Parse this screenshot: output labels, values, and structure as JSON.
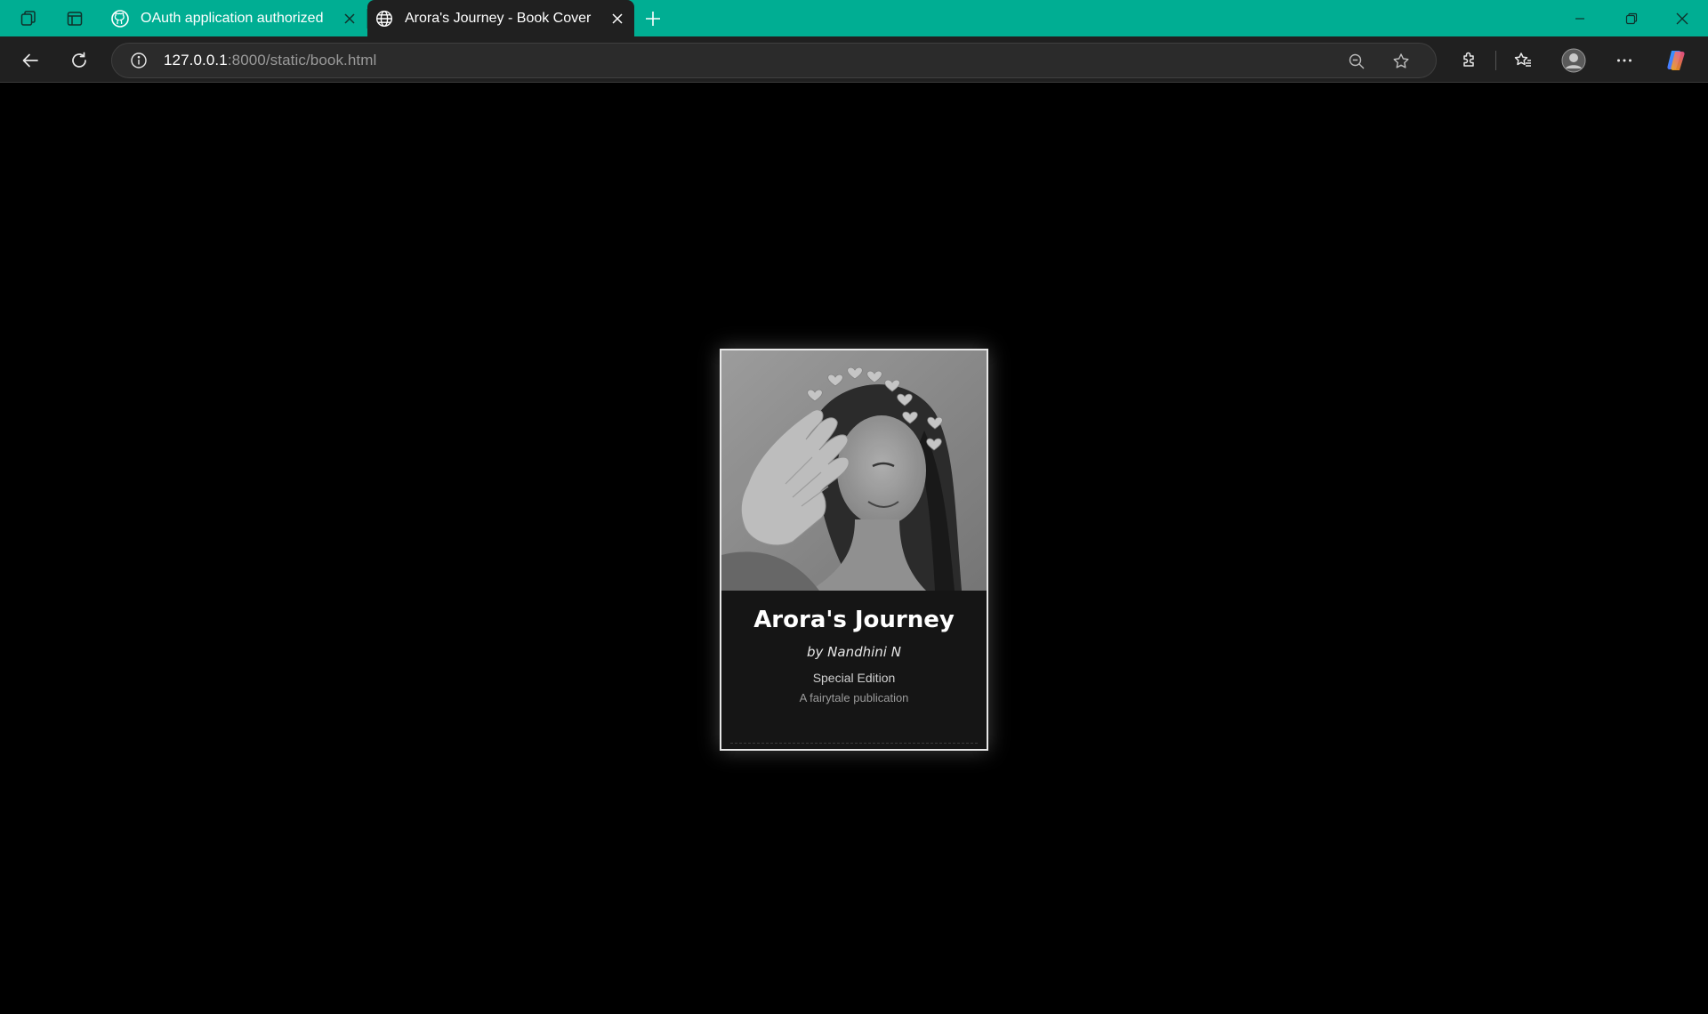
{
  "browser": {
    "tabs": [
      {
        "title": "OAuth application authorized",
        "favicon": "github-icon",
        "active": false
      },
      {
        "title": "Arora's Journey - Book Cover",
        "favicon": "globe-icon",
        "active": true
      }
    ],
    "address": {
      "host": "127.0.0.1",
      "rest": ":8000/static/book.html"
    },
    "colors": {
      "titlebar": "#00ae93",
      "toolbar": "#202020",
      "page_background": "#000000"
    }
  },
  "book": {
    "title": "Arora's Journey",
    "author": "by Nandhini N",
    "edition": "Special Edition",
    "publisher": "A fairytale publication",
    "cover_image": "grayscale-portrait-photo"
  }
}
